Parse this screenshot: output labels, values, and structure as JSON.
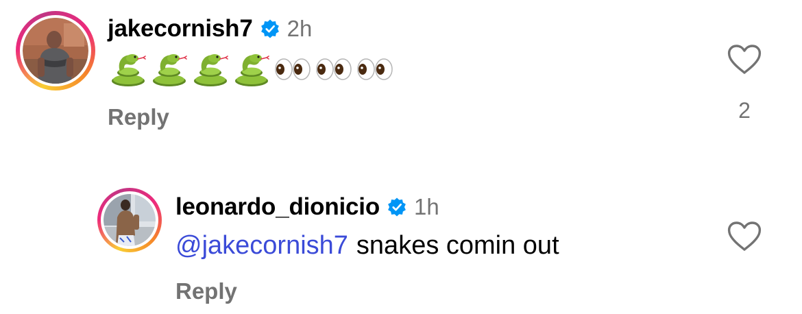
{
  "colors": {
    "username": "#000000",
    "secondary_text": "#737373",
    "mention": "#3b4bd8",
    "verified_badge": "#0095f6",
    "story_ring_start": "#f9ce34",
    "story_ring_mid": "#ee2a7b",
    "story_ring_end": "#c13584"
  },
  "comments": [
    {
      "username": "jakecornish7",
      "verified": true,
      "timestamp": "2h",
      "body_emoji": [
        "snake",
        "snake",
        "snake",
        "snake",
        "eyes",
        "eyes",
        "eyes"
      ],
      "reply_label": "Reply",
      "like_icon": "heart-outline-icon",
      "like_count": "2",
      "avatar": "profile-photo"
    },
    {
      "username": "leonardo_dionicio",
      "verified": true,
      "timestamp": "1h",
      "mention": "@jakecornish7",
      "text": "snakes comin out",
      "reply_label": "Reply",
      "like_icon": "heart-outline-icon",
      "avatar": "profile-photo"
    }
  ]
}
